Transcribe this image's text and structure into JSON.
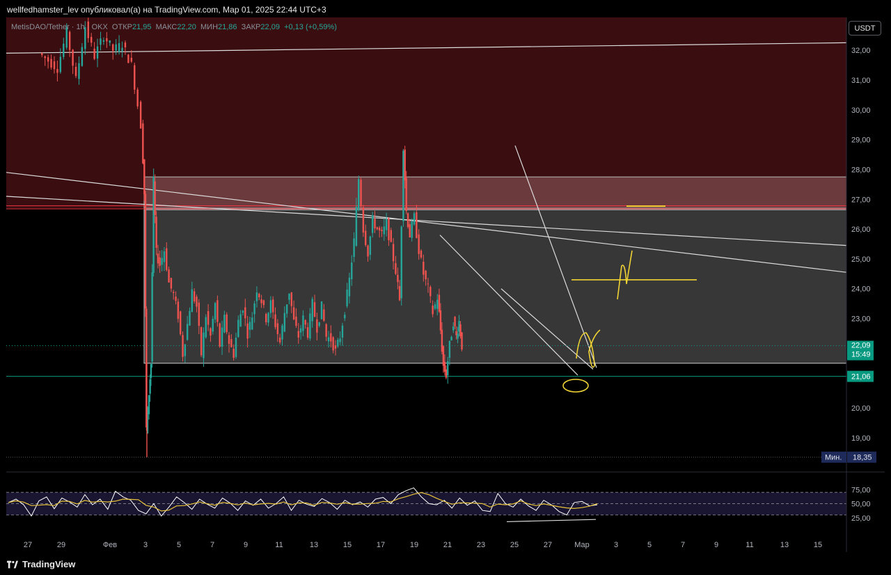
{
  "header": {
    "caption": "wellfedhamster_lev опубликовал(а) на TradingView.com, Мар 01, 2025 22:44 UTC+3"
  },
  "legend": {
    "symbol": "MetisDAO/Tether",
    "interval": "1h",
    "exchange": "OKX",
    "open_label": "ОТКР",
    "open": "21,95",
    "high_label": "МАКС",
    "high": "22,20",
    "low_label": "МИН",
    "low": "21,86",
    "close_label": "ЗАКР",
    "close": "22,09",
    "change": "+0,13 (+0,59%)"
  },
  "currency_button": "USDT",
  "footer": {
    "brand": "TradingView"
  },
  "colors": {
    "up": "#26a69a",
    "down": "#ef5350",
    "resistance_zone": "#3a0e10",
    "supply_zone": "#6b3a3d",
    "range_zone": "#3d3d3d",
    "drawing": "#f0d334",
    "current_price": "#089981",
    "support_line": "#089981",
    "min_label": "#1e2a5a"
  },
  "chart_data": {
    "type": "candlestick",
    "price_axis": {
      "unit": "USDT",
      "ylim": [
        17.9,
        33.1
      ],
      "ticks": [
        "32,00",
        "31,00",
        "30,00",
        "29,00",
        "28,00",
        "27,00",
        "26,00",
        "25,00",
        "24,00",
        "23,00",
        "22,00",
        "21,00",
        "20,00",
        "19,00"
      ],
      "tick_values": [
        32,
        31,
        30,
        29,
        28,
        27,
        26,
        25,
        24,
        23,
        22,
        21,
        20,
        19
      ]
    },
    "time_axis": {
      "labels": [
        "27",
        "29",
        "Фев",
        "3",
        "5",
        "7",
        "9",
        "11",
        "13",
        "15",
        "17",
        "19",
        "21",
        "23",
        "25",
        "27",
        "Мар",
        "3",
        "5",
        "7",
        "9",
        "11",
        "13",
        "15"
      ]
    },
    "price_labels": {
      "current_price": "22,09",
      "countdown": "15:49",
      "support_price": "21,06",
      "min_label": "Мин.",
      "min_price": "18,35"
    },
    "zones": {
      "upper_resistance": [
        26.7,
        33.1
      ],
      "supply_box": [
        26.7,
        27.75
      ],
      "range_box": [
        21.5,
        26.65
      ]
    },
    "support_level": 21.06,
    "current_price_value": 22.09,
    "low_value": 18.35,
    "price_path": [
      [
        0,
        31.9
      ],
      [
        2,
        31.4
      ],
      [
        3,
        32.6
      ],
      [
        4,
        31.0
      ],
      [
        5,
        32.8
      ],
      [
        6,
        31.8
      ],
      [
        7,
        32.5
      ],
      [
        8,
        32.0
      ],
      [
        9,
        32.2
      ],
      [
        10,
        31.5
      ],
      [
        11,
        29.5
      ],
      [
        11.3,
        27.2
      ],
      [
        11.5,
        19.3
      ],
      [
        11.8,
        20.5
      ],
      [
        12,
        21.5
      ],
      [
        12.3,
        27.6
      ],
      [
        12.6,
        25.2
      ],
      [
        13,
        24.8
      ],
      [
        13.5,
        25.3
      ],
      [
        14,
        24.2
      ],
      [
        14.5,
        23.8
      ],
      [
        15,
        23.1
      ],
      [
        15.5,
        21.8
      ],
      [
        16,
        22.8
      ],
      [
        16.5,
        23.9
      ],
      [
        17,
        23.4
      ],
      [
        17.5,
        21.8
      ],
      [
        18,
        23.1
      ],
      [
        18.5,
        22.4
      ],
      [
        19,
        23.5
      ],
      [
        19.5,
        22.1
      ],
      [
        20,
        23.0
      ],
      [
        20.5,
        22.2
      ],
      [
        21,
        21.8
      ],
      [
        21.5,
        22.9
      ],
      [
        22,
        23.4
      ],
      [
        22.5,
        22.5
      ],
      [
        23,
        23.1
      ],
      [
        23.5,
        24.0
      ],
      [
        24,
        23.6
      ],
      [
        24.5,
        23.0
      ],
      [
        25,
        23.5
      ],
      [
        25.5,
        22.8
      ],
      [
        26,
        22.2
      ],
      [
        26.5,
        23.2
      ],
      [
        27,
        23.9
      ],
      [
        27.5,
        22.9
      ],
      [
        28,
        22.4
      ],
      [
        28.5,
        23.0
      ],
      [
        29,
        22.5
      ],
      [
        29.5,
        23.5
      ],
      [
        30,
        22.7
      ],
      [
        30.5,
        23.4
      ],
      [
        31,
        22.4
      ],
      [
        31.5,
        22.3
      ],
      [
        32,
        21.9
      ],
      [
        32.5,
        22.4
      ],
      [
        33,
        23.3
      ],
      [
        33.5,
        24.3
      ],
      [
        34,
        25.6
      ],
      [
        34.5,
        27.7
      ],
      [
        35,
        26.0
      ],
      [
        35.5,
        25.2
      ],
      [
        36,
        26.3
      ],
      [
        36.5,
        26.0
      ],
      [
        37,
        25.8
      ],
      [
        37.5,
        26.2
      ],
      [
        38,
        25.4
      ],
      [
        38.5,
        24.6
      ],
      [
        38.9,
        23.6
      ],
      [
        39.3,
        28.8
      ],
      [
        39.6,
        26.6
      ],
      [
        40,
        25.8
      ],
      [
        40.5,
        26.4
      ],
      [
        41,
        25.3
      ],
      [
        41.5,
        24.5
      ],
      [
        42,
        24.0
      ],
      [
        42.5,
        23.2
      ],
      [
        43,
        23.7
      ],
      [
        43.3,
        22.6
      ],
      [
        43.6,
        21.4
      ],
      [
        43.9,
        21.1
      ],
      [
        44.3,
        22.1
      ],
      [
        44.7,
        22.9
      ],
      [
        45,
        22.4
      ],
      [
        45.3,
        22.9
      ],
      [
        45.6,
        22.09
      ]
    ],
    "rsi": {
      "ticks": [
        "75,00",
        "50,00",
        "25,00"
      ],
      "tick_values": [
        75,
        50,
        25
      ],
      "band": [
        30,
        70
      ],
      "values": [
        52,
        58,
        48,
        28,
        55,
        62,
        41,
        60,
        53,
        44,
        66,
        48,
        58,
        40,
        72,
        62,
        56,
        38,
        32,
        50,
        28,
        44,
        62,
        52,
        40,
        58,
        49,
        42,
        60,
        51,
        38,
        55,
        47,
        58,
        42,
        50,
        62,
        38,
        56,
        49,
        45,
        59,
        52,
        40,
        56,
        48,
        53,
        44,
        58,
        61,
        50,
        66,
        73,
        78,
        62,
        50,
        48,
        56,
        42,
        60,
        47,
        55,
        38,
        36,
        68,
        50,
        44,
        58,
        46,
        38,
        56,
        48,
        36,
        30,
        52,
        54,
        46,
        48
      ]
    }
  },
  "annotations": {
    "yellow_scribble": "N"
  }
}
